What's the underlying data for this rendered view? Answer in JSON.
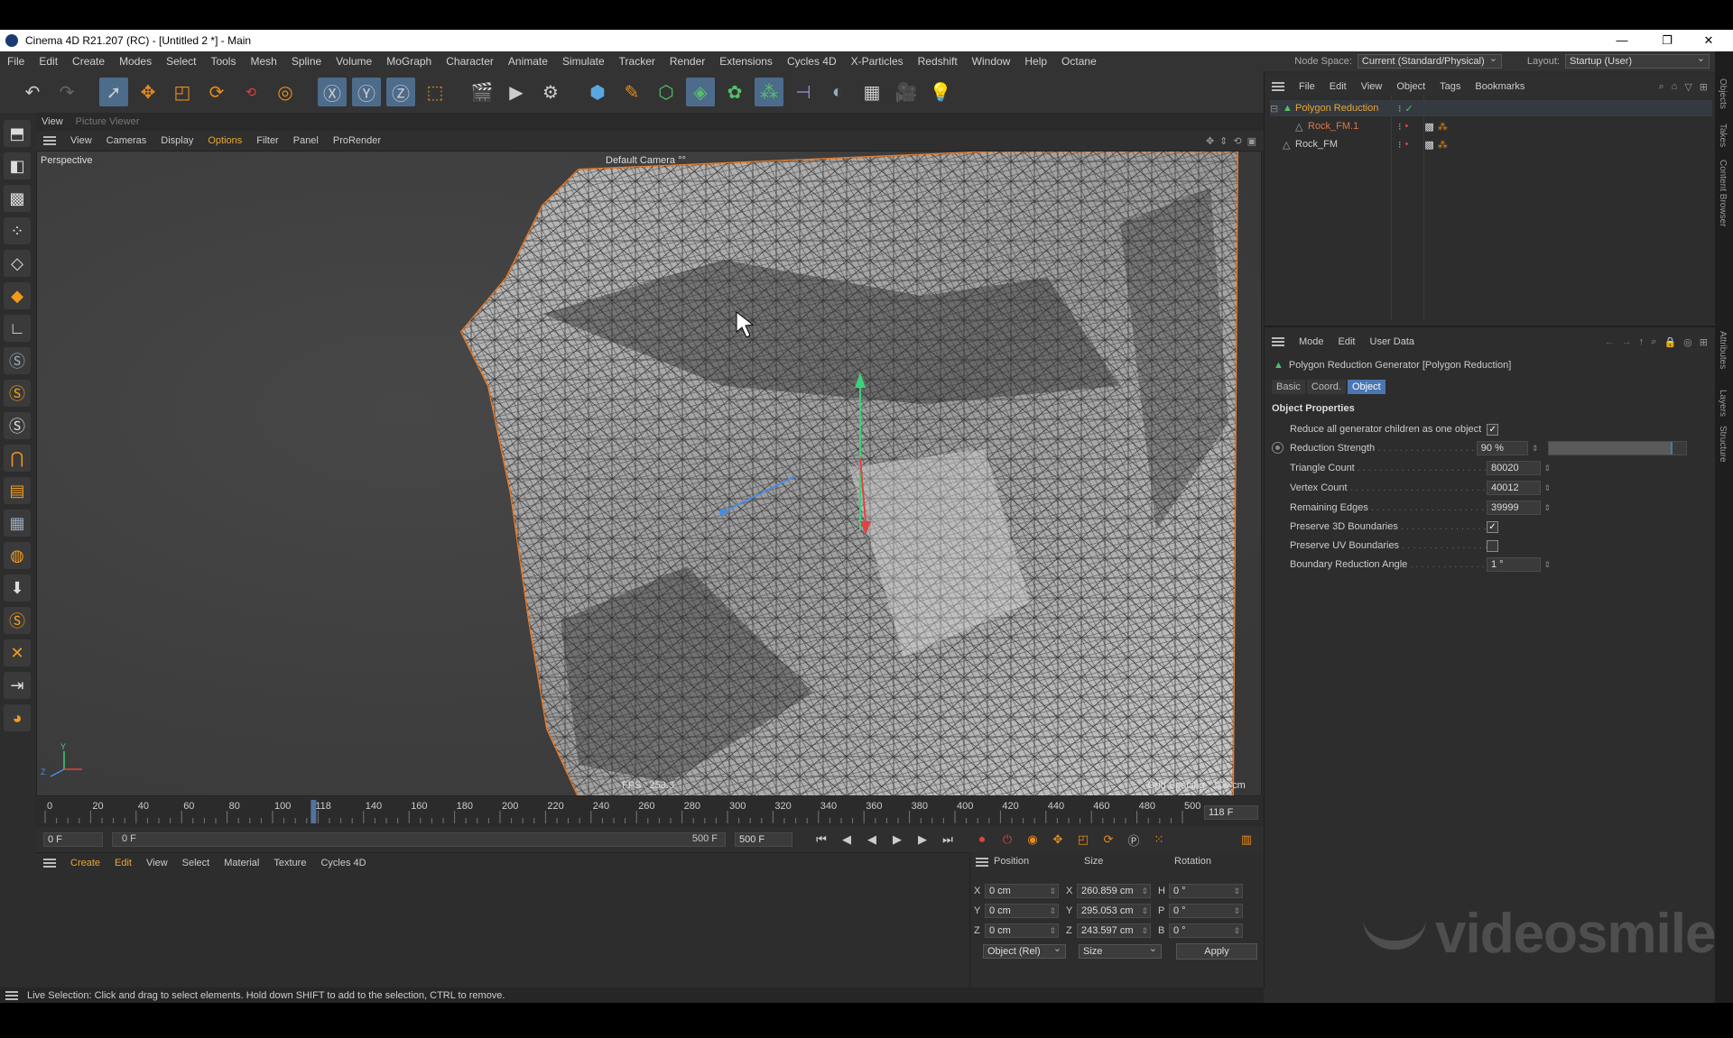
{
  "window": {
    "title": "Cinema 4D R21.207 (RC) - [Untitled 2 *] - Main",
    "controls": [
      "—",
      "❐",
      "✕"
    ]
  },
  "menubar": {
    "items": [
      "File",
      "Edit",
      "Create",
      "Modes",
      "Select",
      "Tools",
      "Mesh",
      "Spline",
      "Volume",
      "MoGraph",
      "Character",
      "Animate",
      "Simulate",
      "Tracker",
      "Render",
      "Extensions",
      "Cycles 4D",
      "X-Particles",
      "Redshift",
      "Window",
      "Help",
      "Octane"
    ],
    "node_space_label": "Node Space:",
    "node_space_value": "Current (Standard/Physical)",
    "layout_label": "Layout:",
    "layout_value": "Startup (User)"
  },
  "viewport": {
    "tabs": [
      "View",
      "Picture Viewer"
    ],
    "menu": [
      "View",
      "Cameras",
      "Display",
      "Options",
      "Filter",
      "Panel",
      "ProRender"
    ],
    "projection": "Perspective",
    "camera": "Default Camera °°",
    "fps": "FPS : 253.3",
    "grid_spacing": "Grid Spacing : 100 cm",
    "axis_y": "Y",
    "axis_z": "Z",
    "axis_x": "X"
  },
  "timeline": {
    "ticks": [
      "0",
      "20",
      "40",
      "60",
      "80",
      "100",
      "118",
      "140",
      "160",
      "180",
      "200",
      "220",
      "240",
      "260",
      "280",
      "300",
      "320",
      "340",
      "360",
      "380",
      "400",
      "420",
      "440",
      "460",
      "480",
      "500"
    ],
    "current_frame": "118 F",
    "playhead_fraction": 0.236,
    "start_field": "0 F",
    "range_start": "0 F",
    "range_end": "500 F",
    "end_field": "500 F"
  },
  "material_manager": {
    "menu": [
      "Create",
      "Edit",
      "View",
      "Select",
      "Material",
      "Texture",
      "Cycles 4D"
    ]
  },
  "coordinates": {
    "headers": [
      "Position",
      "Size",
      "Rotation"
    ],
    "rows": [
      {
        "axis": "X",
        "pos": "0 cm",
        "size_axis": "X",
        "size": "260.859 cm",
        "rot_axis": "H",
        "rot": "0 °"
      },
      {
        "axis": "Y",
        "pos": "0 cm",
        "size_axis": "Y",
        "size": "295.053 cm",
        "rot_axis": "P",
        "rot": "0 °"
      },
      {
        "axis": "Z",
        "pos": "0 cm",
        "size_axis": "Z",
        "size": "243.597 cm",
        "rot_axis": "B",
        "rot": "0 °"
      }
    ],
    "mode_dropdown": "Object (Rel)",
    "size_dropdown": "Size",
    "apply_label": "Apply"
  },
  "status": {
    "text": "Live Selection: Click and drag to select elements. Hold down SHIFT to add to the selection, CTRL to remove."
  },
  "object_manager": {
    "menu": [
      "File",
      "Edit",
      "View",
      "Object",
      "Tags",
      "Bookmarks"
    ],
    "objects": [
      {
        "name": "Polygon Reduction",
        "color": "#e7a533"
      },
      {
        "name": "Rock_FM.1",
        "color": "#d9794a"
      },
      {
        "name": "Rock_FM",
        "color": "#cccccc"
      }
    ]
  },
  "attributes": {
    "menu": [
      "Mode",
      "Edit",
      "User Data"
    ],
    "title": "Polygon Reduction Generator [Polygon Reduction]",
    "tabs": [
      "Basic",
      "Coord.",
      "Object"
    ],
    "active_tab": "Object",
    "section": "Object Properties",
    "props": {
      "reduce_all_label": "Reduce all generator children as one object",
      "reduce_all_checked": "✓",
      "strength_label": "Reduction Strength",
      "strength_value": "90 %",
      "strength_fraction": 0.9,
      "triangle_label": "Triangle Count",
      "triangle_value": "80020",
      "vertex_label": "Vertex Count",
      "vertex_value": "40012",
      "edges_label": "Remaining Edges",
      "edges_value": "39999",
      "preserve3d_label": "Preserve 3D Boundaries",
      "preserve3d_checked": "✓",
      "preserveuv_label": "Preserve UV Boundaries",
      "preserveuv_checked": "",
      "angle_label": "Boundary Reduction Angle",
      "angle_value": "1 °"
    }
  },
  "side_tabs": [
    "Objects",
    "Takes",
    "Content Browser",
    "Attributes",
    "Layers",
    "Structure"
  ],
  "watermark": "videosmile",
  "colors": {
    "accent_orange": "#e7a533",
    "active_tab_blue": "#4a76b4",
    "panel_bg": "#2d2d2d"
  }
}
